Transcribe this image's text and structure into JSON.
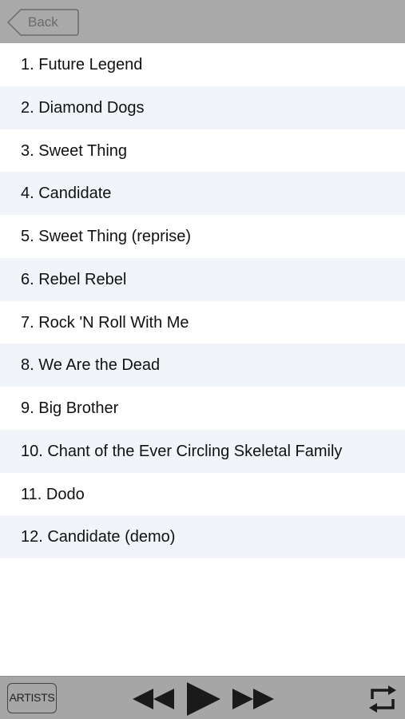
{
  "navbar": {
    "back_label": "Back"
  },
  "tracks": [
    "1. Future Legend",
    "2. Diamond Dogs",
    "3. Sweet Thing",
    "4. Candidate",
    "5. Sweet Thing (reprise)",
    "6. Rebel Rebel",
    "7. Rock 'N Roll With Me",
    "8. We Are the Dead",
    "9. Big Brother",
    "10. Chant of the Ever Circling Skeletal Family",
    "11. Dodo",
    "12. Candidate (demo)"
  ],
  "toolbar": {
    "artists_label": "ARTISTS",
    "rewind_icon": "rewind-icon",
    "play_icon": "play-icon",
    "forward_icon": "fast-forward-icon",
    "repeat_icon": "repeat-icon"
  },
  "colors": {
    "bar_gray": "#a9a9a9",
    "alt_row": "#f1f5f9",
    "text": "#111111"
  }
}
